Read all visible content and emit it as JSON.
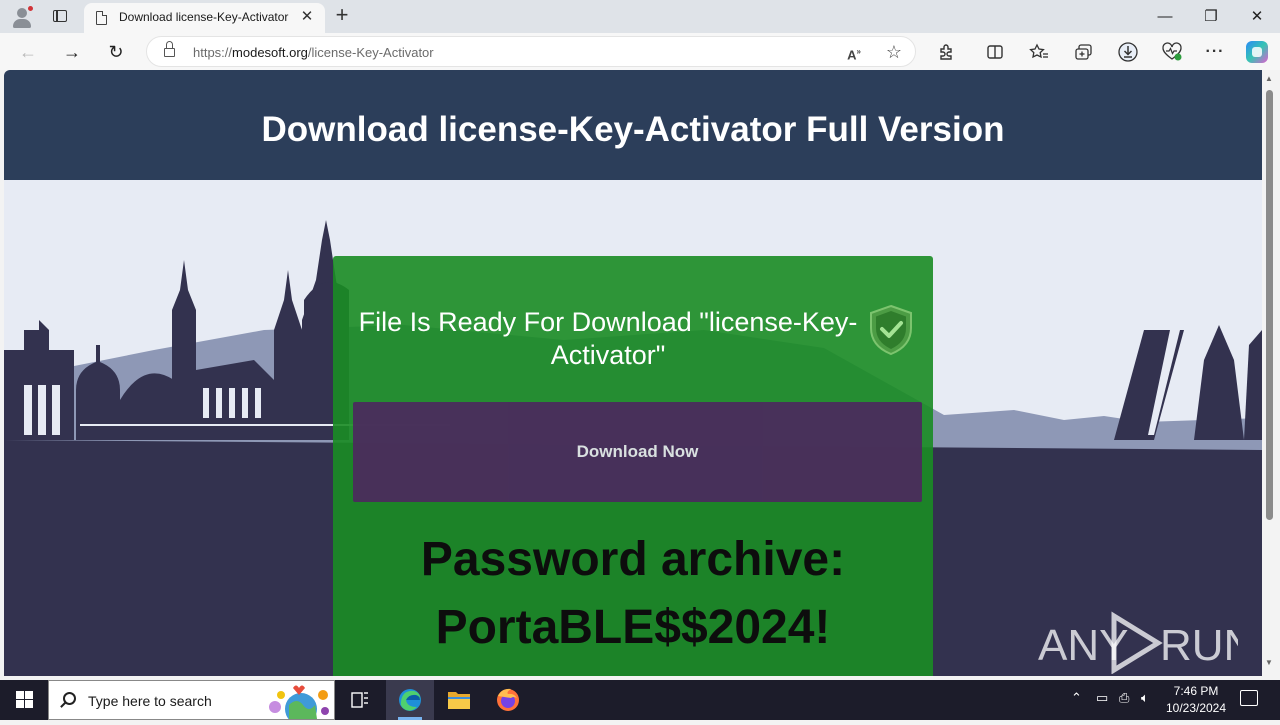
{
  "browser": {
    "tab": {
      "title": "Download license-Key-Activator",
      "close_glyph": "✕"
    },
    "new_tab_glyph": "+",
    "window_controls": {
      "minimize": "—",
      "maximize": "❐",
      "close": "✕"
    },
    "nav": {
      "back": "←",
      "forward": "→",
      "refresh": "↻"
    },
    "address": {
      "scheme": "https://",
      "host": "modesoft.org",
      "path": "/license-Key-Activator"
    },
    "omnibox_icons": [
      "read-aloud-icon",
      "favorite-star-icon"
    ],
    "toolbar_icons": [
      "extensions-icon",
      "split-screen-icon",
      "favorites-icon",
      "collections-icon",
      "downloads-icon",
      "browser-essentials-icon",
      "more-icon",
      "copilot-icon"
    ]
  },
  "page": {
    "header_title": "Download license-Key-Activator Full Version",
    "ready_text": "File Is Ready For Download \"license-Key-Activator\"",
    "download_button": "Download Now",
    "password_line1": "Password archive:",
    "password_line2": "PortaBLE$$2024!",
    "colors": {
      "header": "#2c3e5a",
      "card": "#198c23",
      "button": "#4b2a5e",
      "skyline": "#33324f"
    }
  },
  "watermark": {
    "text_left": "ANY",
    "text_right": "RUN"
  },
  "taskbar": {
    "search_placeholder": "Type here to search",
    "apps": [
      "task-view-icon",
      "edge-icon",
      "file-explorer-icon",
      "firefox-icon"
    ],
    "clock_time": "7:46 PM",
    "clock_date": "10/23/2024"
  }
}
